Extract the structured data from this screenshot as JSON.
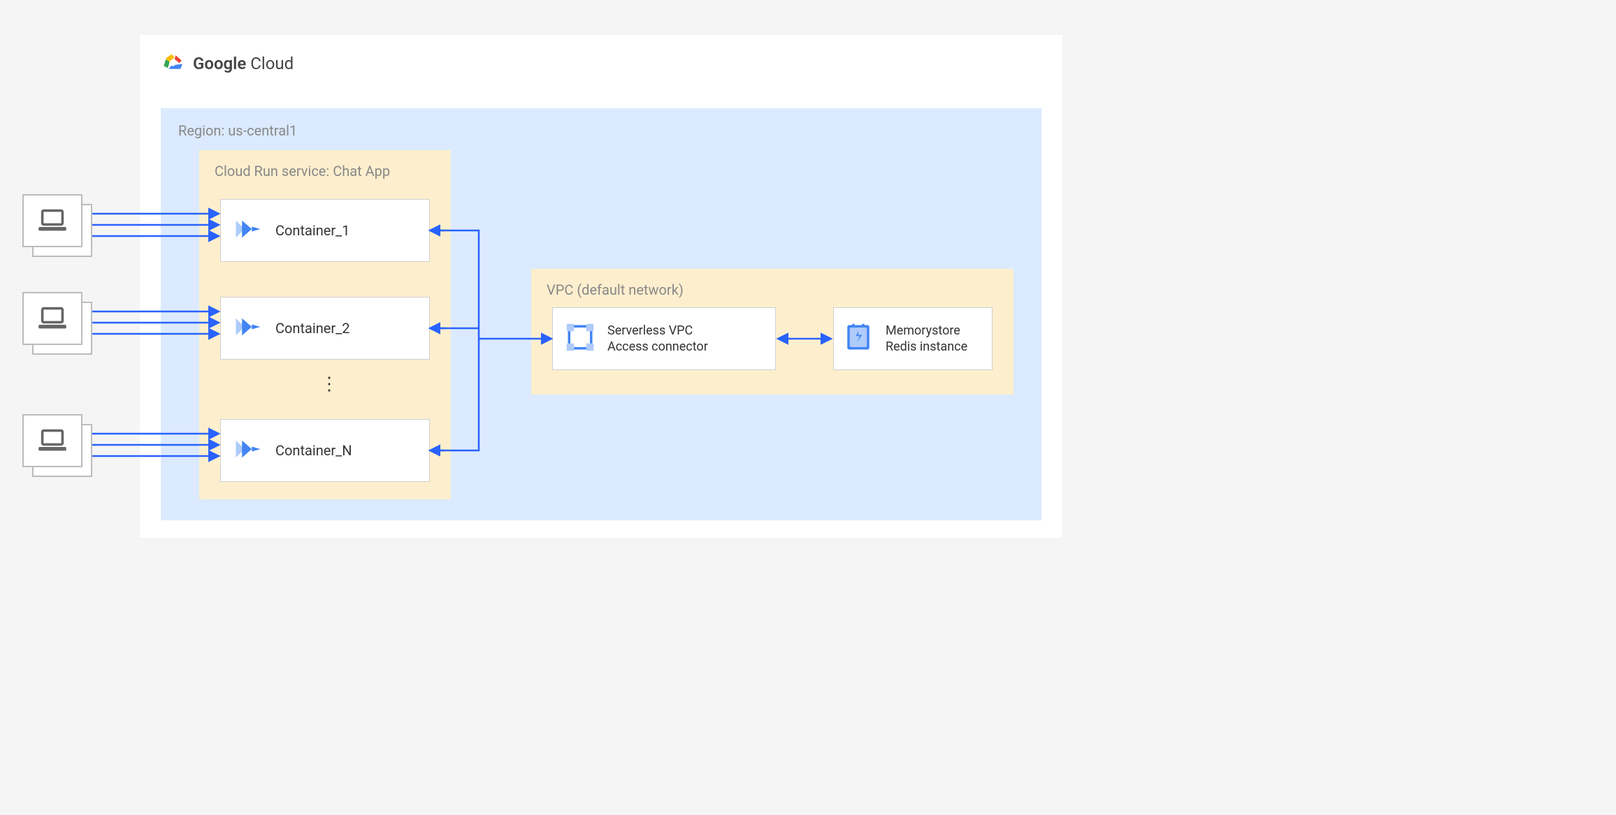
{
  "header": {
    "brand_bold": "Google",
    "brand_light": "Cloud"
  },
  "region": {
    "label": "Region: us-central1"
  },
  "cloudrun": {
    "label": "Cloud Run service: Chat App",
    "containers": {
      "c1": "Container_1",
      "c2": "Container_2",
      "cn": "Container_N"
    }
  },
  "vpc": {
    "label": "VPC (default network)",
    "connector_line1": "Serverless VPC",
    "connector_line2": "Access connector",
    "redis_line1": "Memorystore",
    "redis_line2": "Redis instance"
  },
  "icons": {
    "cloudrun": "cloud-run-icon",
    "vpc_connector": "vpc-connector-icon",
    "memorystore": "memorystore-icon",
    "laptop": "laptop-icon",
    "cloud_logo": "google-cloud-logo-icon"
  },
  "colors": {
    "region_bg": "#dbeafe",
    "group_bg": "#fdefce",
    "arrow": "#2962ff",
    "border": "#d0d0d0",
    "text_muted": "#888888"
  }
}
